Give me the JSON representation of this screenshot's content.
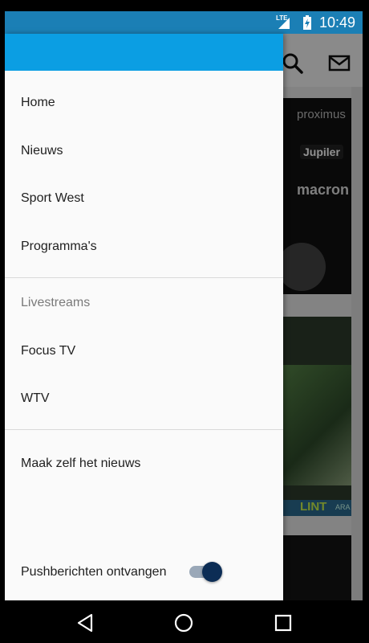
{
  "status_bar": {
    "network": "LTE",
    "time": "10:49"
  },
  "drawer": {
    "items": [
      {
        "label": "Home"
      },
      {
        "label": "Nieuws"
      },
      {
        "label": "Sport West"
      },
      {
        "label": "Programma's"
      }
    ],
    "livestreams": {
      "header": "Livestreams",
      "items": [
        {
          "label": "Focus TV"
        },
        {
          "label": "WTV"
        }
      ]
    },
    "extra": {
      "label": "Maak zelf het nieuws"
    },
    "push": {
      "label": "Pushberichten ontvangen",
      "enabled": true
    }
  },
  "background": {
    "card1_brands": [
      "proximus",
      "Jupiler",
      "macron"
    ],
    "card2_label": "LINT",
    "card2_tag": "ARA"
  },
  "colors": {
    "accent": "#0b9ee3",
    "status_bar": "#1b7fb5",
    "switch_thumb": "#0c2d55"
  },
  "icons": {
    "search": "search-icon",
    "mail": "mail-icon"
  }
}
